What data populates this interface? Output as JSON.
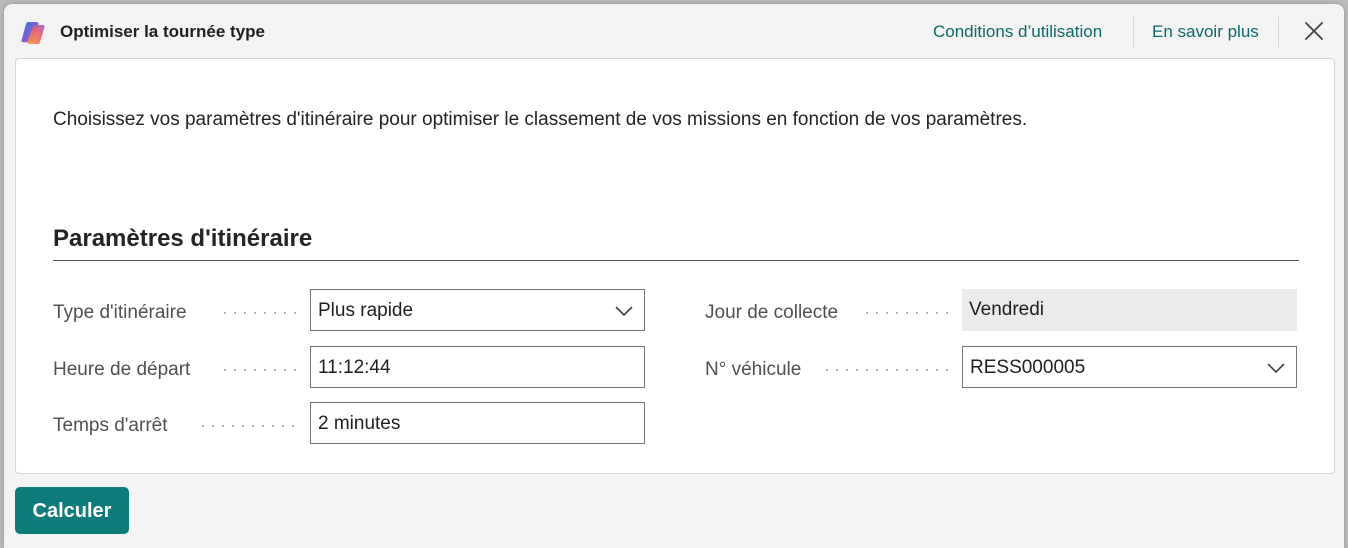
{
  "dialog": {
    "title": "Optimiser la tournée type",
    "app_icon": "copilot-logo",
    "links": {
      "terms": "Conditions d’utilisation",
      "learn_more": "En savoir plus"
    },
    "close_icon": "close-icon"
  },
  "intro_text": "Choisissez vos paramètres d'itinéraire pour optimiser le classement de vos missions en fonction de vos paramètres.",
  "section": {
    "title": "Paramètres d'itinéraire"
  },
  "fields": {
    "route_type": {
      "label": "Type d'itinéraire",
      "value": "Plus rapide"
    },
    "departure_time": {
      "label": "Heure de départ",
      "value": "11:12:44"
    },
    "stop_time": {
      "label": "Temps d'arrêt",
      "value": "2 minutes"
    },
    "collection_day": {
      "label": "Jour de collecte",
      "value": "Vendredi"
    },
    "vehicle_no": {
      "label": "N° véhicule",
      "value": "RESS000005"
    }
  },
  "actions": {
    "calculate": "Calculer"
  },
  "colors": {
    "accent": "#0e7c7b",
    "link": "#0b6a6a",
    "readonly_bg": "#ebebeb"
  }
}
